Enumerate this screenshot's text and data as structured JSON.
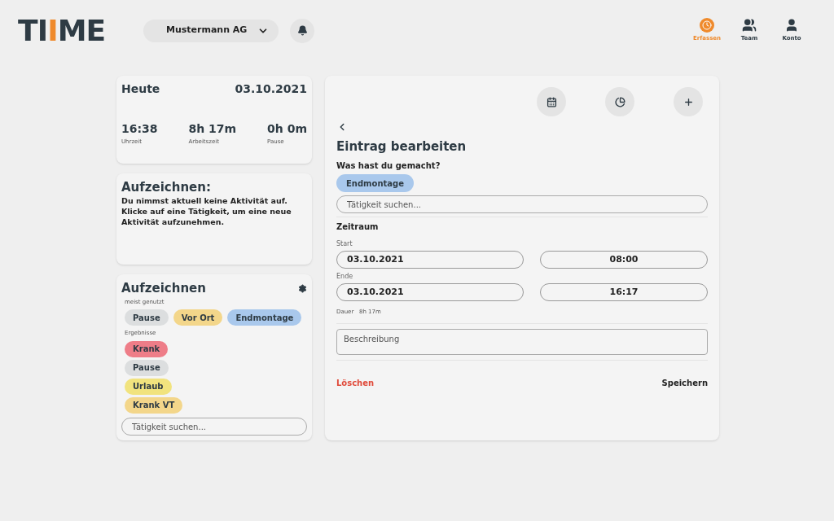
{
  "logo": [
    {
      "text": "TI",
      "color": "#2e3b44"
    },
    {
      "text": "I",
      "color": "#ef8a2c"
    },
    {
      "text": "ME",
      "color": "#2e3b44"
    }
  ],
  "company_select": {
    "value": "Mustermann AG"
  },
  "nav": [
    {
      "label": "Erfassen",
      "kind": "clock",
      "selected": true
    },
    {
      "label": "Team",
      "kind": "team",
      "selected": false
    },
    {
      "label": "Konto",
      "kind": "user",
      "selected": false
    }
  ],
  "today": {
    "title": "Heute",
    "date": "03.10.2021",
    "stats": [
      {
        "value": "16:38",
        "label": "Uhrzeit"
      },
      {
        "value": "8h 17m",
        "label": "Arbeitszeit"
      },
      {
        "value": "0h 0m",
        "label": "Pause"
      }
    ]
  },
  "recording_info": {
    "title": "Aufzeichnen:",
    "text": "Du nimmst aktuell keine Aktivität auf. Klicke auf eine Tätigkeit, um eine neue Aktivität aufzunehmen."
  },
  "recorder": {
    "title": "Aufzeichnen",
    "most_used_label": "meist genutzt",
    "most_used": [
      {
        "label": "Pause",
        "color": "#dcdedf"
      },
      {
        "label": "Vor Ort",
        "color": "#f3d68a"
      },
      {
        "label": "Endmontage",
        "color": "#a9c8ec"
      }
    ],
    "results_label": "Ergebnisse",
    "results": [
      {
        "label": "Krank",
        "color": "#ee7d88"
      },
      {
        "label": "Pause",
        "color": "#dcdedf"
      },
      {
        "label": "Urlaub",
        "color": "#f1e37e"
      },
      {
        "label": "Krank VT",
        "color": "#f3d68a"
      }
    ],
    "search": {
      "placeholder": "Tätigkeit suchen..."
    }
  },
  "editor": {
    "toolbar": [
      {
        "kind": "calendar"
      },
      {
        "kind": "pie"
      },
      {
        "kind": "plus"
      }
    ],
    "title": "Eintrag bearbeiten",
    "question": "Was hast du gemacht?",
    "activity": {
      "label": "Endmontage",
      "color": "#a9c8ec"
    },
    "search": {
      "placeholder": "Tätigkeit suchen..."
    },
    "period_label": "Zeitraum",
    "start": {
      "label": "Start",
      "date": "03.10.2021",
      "time": "08:00"
    },
    "end": {
      "label": "Ende",
      "date": "03.10.2021",
      "time": "16:17"
    },
    "duration_label": "Dauer",
    "duration": "8h 17m",
    "description": {
      "placeholder": "Beschreibung"
    },
    "delete": "Löschen",
    "save": "Speichern"
  }
}
